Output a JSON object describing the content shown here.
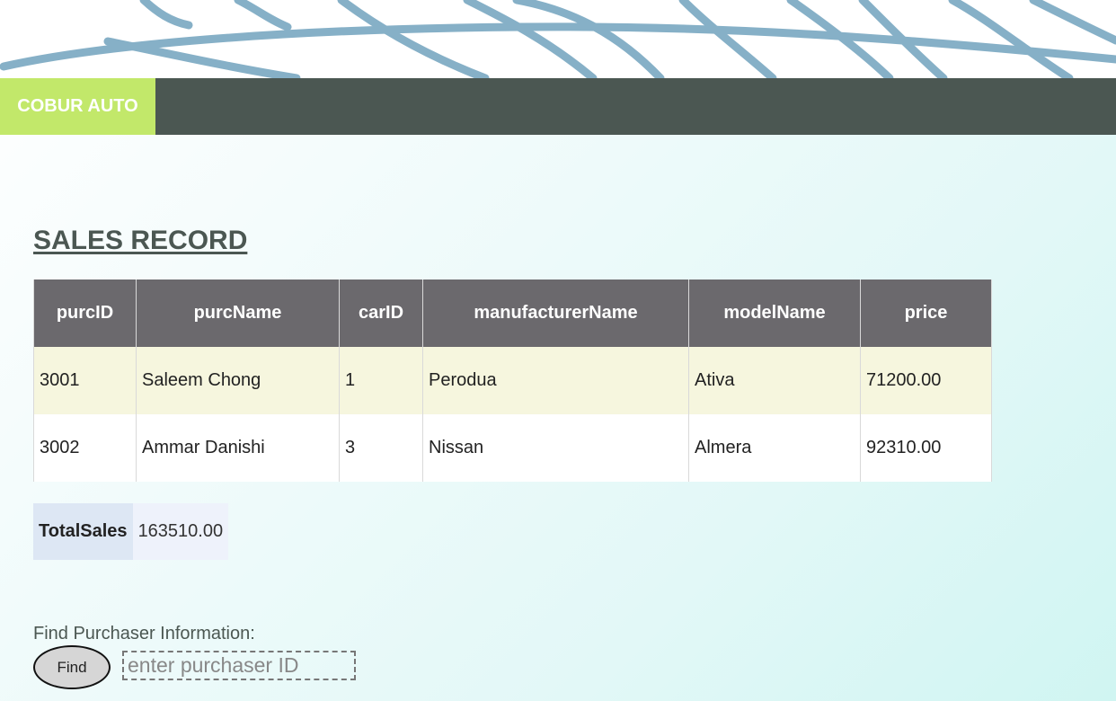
{
  "brand": {
    "name": "COBUR AUTO"
  },
  "page": {
    "title": "SALES RECORD"
  },
  "sales_table": {
    "headers": [
      "purcID",
      "purcName",
      "carID",
      "manufacturerName",
      "modelName",
      "price"
    ],
    "rows": [
      [
        "3001",
        "Saleem Chong",
        "1",
        "Perodua",
        "Ativa",
        "71200.00"
      ],
      [
        "3002",
        "Ammar Danishi",
        "3",
        "Nissan",
        "Almera",
        "92310.00"
      ]
    ]
  },
  "total": {
    "label": "TotalSales",
    "value": "163510.00"
  },
  "find": {
    "label": "Find Purchaser Information:",
    "button_label": "Find",
    "input_placeholder": "enter purchaser ID",
    "input_value": ""
  },
  "colors": {
    "brand_accent": "#c2e86a",
    "navbar": "#4b5752",
    "table_header": "#6b696d",
    "row_highlight": "#f6f6de",
    "banner_wave": "#86b0c7"
  },
  "icons": {
    "banner": "wave-pattern-decoration"
  }
}
